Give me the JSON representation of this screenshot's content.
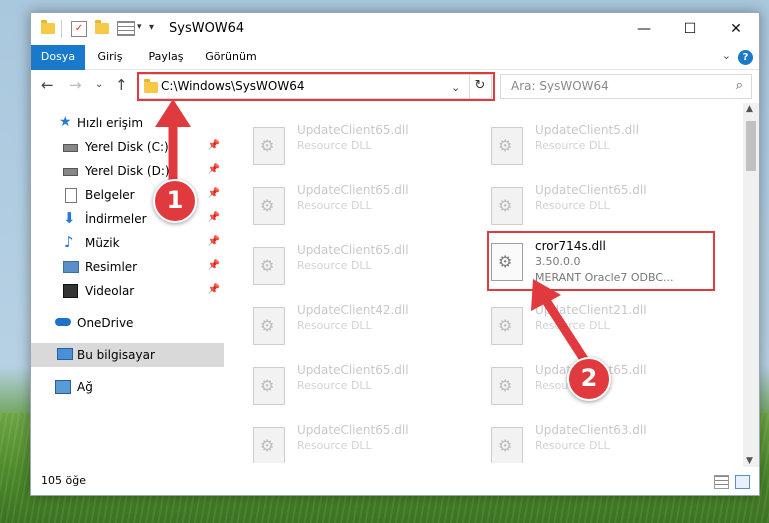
{
  "window": {
    "title": "SysWOW64",
    "controls": {
      "minimize": "—",
      "maximize": "☐",
      "close": "✕"
    }
  },
  "ribbon": {
    "tabs": [
      "Dosya",
      "Giriş",
      "Paylaş",
      "Görünüm"
    ],
    "help": "?",
    "collapse": "⌄"
  },
  "nav": {
    "back": "←",
    "forward": "→",
    "recent": "⌄",
    "up": "↑",
    "address": "C:\\Windows\\SysWOW64",
    "address_dropdown": "⌄",
    "refresh": "↻",
    "search_placeholder": "Ara: SysWOW64",
    "search_icon": "⌕"
  },
  "sidebar": {
    "pin": "📌",
    "items": [
      {
        "label": "Hızlı erişim",
        "icon": "star-icon"
      },
      {
        "label": "Yerel Disk (C:)",
        "icon": "drive-icon",
        "pinned": true
      },
      {
        "label": "Yerel Disk (D:)",
        "icon": "drive-icon",
        "pinned": true
      },
      {
        "label": "Belgeler",
        "icon": "documents-icon",
        "pinned": true
      },
      {
        "label": "İndirmeler",
        "icon": "download-icon",
        "pinned": true
      },
      {
        "label": "Müzik",
        "icon": "music-icon",
        "pinned": true
      },
      {
        "label": "Resimler",
        "icon": "pictures-icon",
        "pinned": true
      },
      {
        "label": "Videolar",
        "icon": "video-icon",
        "pinned": true
      },
      {
        "label": "OneDrive",
        "icon": "cloud-icon"
      },
      {
        "label": "Bu bilgisayar",
        "icon": "computer-icon",
        "selected": true
      },
      {
        "label": "Ağ",
        "icon": "network-icon"
      }
    ]
  },
  "files": [
    {
      "name": "UpdateClient65.dll",
      "type": "Resource DLL"
    },
    {
      "name": "UpdateClient5.dll",
      "type": "Resource DLL"
    },
    {
      "name": "UpdateClient65.dll",
      "type": "Resource DLL"
    },
    {
      "name": "UpdateClient65.dll",
      "type": "Resource DLL"
    },
    {
      "name": "UpdateClient65.dll",
      "type": "Resource DLL"
    },
    {
      "name": "cror714s.dll",
      "version": "3.50.0.0",
      "type": "MERANT Oracle7 ODBC...",
      "highlighted": true
    },
    {
      "name": "UpdateClient42.dll",
      "type": "Resource DLL"
    },
    {
      "name": "UpdateClient21.dll",
      "type": "Resource DLL"
    },
    {
      "name": "UpdateClient65.dll",
      "type": "Resource DLL"
    },
    {
      "name": "UpdateClient65.dll",
      "type": "Resource DLL"
    },
    {
      "name": "UpdateClient65.dll",
      "type": "Resource DLL"
    },
    {
      "name": "UpdateClient63.dll",
      "type": "Resource DLL"
    }
  ],
  "scroll": {
    "up": "▲",
    "down": "▼"
  },
  "status": {
    "count": "105 öğe"
  },
  "annotations": {
    "step1": "1",
    "step2": "2"
  },
  "colors": {
    "accent": "#1979ca",
    "highlight": "#e03a3e"
  }
}
